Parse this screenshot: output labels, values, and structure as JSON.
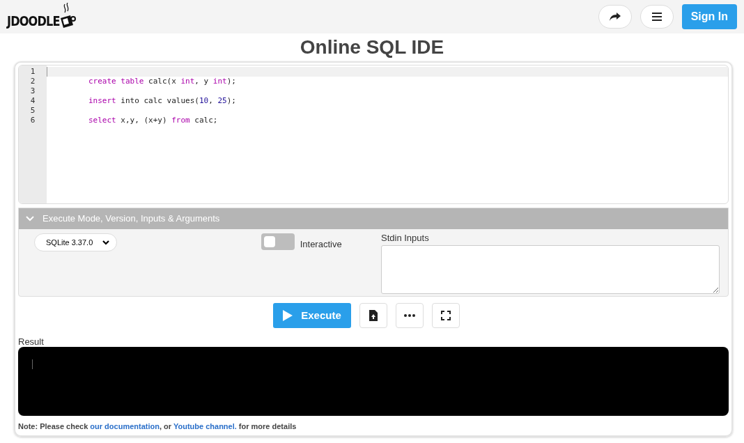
{
  "header": {
    "logo_text": "JDOODLE",
    "sign_in": "Sign In"
  },
  "title": "Online SQL IDE",
  "editor": {
    "lines": [
      {
        "number": "1"
      },
      {
        "number": "2",
        "tokens": [
          {
            "text": "create table",
            "kind": "keyword"
          },
          {
            "text": " calc(x ",
            "kind": "plain"
          },
          {
            "text": "int",
            "kind": "keyword"
          },
          {
            "text": ", y ",
            "kind": "plain"
          },
          {
            "text": "int",
            "kind": "keyword"
          },
          {
            "text": ");",
            "kind": "plain"
          }
        ]
      },
      {
        "number": "3"
      },
      {
        "number": "4",
        "tokens": [
          {
            "text": "insert",
            "kind": "keyword"
          },
          {
            "text": " into calc values(",
            "kind": "plain"
          },
          {
            "text": "10",
            "kind": "number"
          },
          {
            "text": ", ",
            "kind": "plain"
          },
          {
            "text": "25",
            "kind": "number"
          },
          {
            "text": ");",
            "kind": "plain"
          }
        ]
      },
      {
        "number": "5"
      },
      {
        "number": "6",
        "tokens": [
          {
            "text": "select",
            "kind": "keyword"
          },
          {
            "text": " x,y, (x+y) ",
            "kind": "plain"
          },
          {
            "text": "from",
            "kind": "keyword"
          },
          {
            "text": " calc;",
            "kind": "plain"
          }
        ]
      }
    ]
  },
  "options": {
    "heading": "Execute Mode, Version, Inputs & Arguments",
    "expanded": true,
    "version": "SQLite 3.37.0",
    "interactive": {
      "label": "Interactive",
      "on": false
    },
    "stdin_label": "Stdin Inputs"
  },
  "execute_button": "Execute",
  "result": {
    "label": "Result"
  },
  "note": [
    {
      "text": "Note: Please check ",
      "kind": "text"
    },
    {
      "text": "our documentation",
      "kind": "link"
    },
    {
      "text": ", or ",
      "kind": "text"
    },
    {
      "text": "Youtube channel.",
      "kind": "link"
    },
    {
      "text": " for more details",
      "kind": "text"
    }
  ]
}
